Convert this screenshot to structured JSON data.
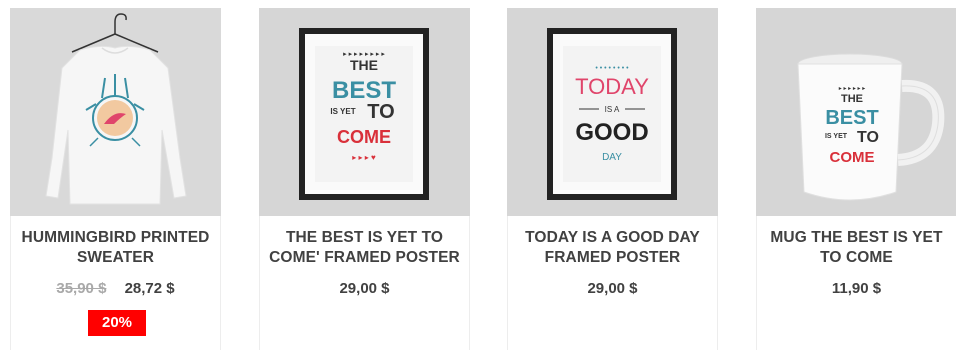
{
  "products": [
    {
      "title": "HUMMINGBIRD PRINTED SWEATER",
      "old_price": "35,90 $",
      "price": "28,72 $",
      "discount": "20%"
    },
    {
      "title": "THE BEST IS YET TO COME' FRAMED POSTER",
      "price": "29,00 $",
      "poster_text": {
        "the": "THE",
        "best": "BEST",
        "is_yet": "IS YET",
        "to": "TO",
        "come": "COME"
      }
    },
    {
      "title": "TODAY IS A GOOD DAY FRAMED POSTER",
      "price": "29,00 $",
      "poster_text": {
        "today": "TODAY",
        "is_a": "IS A",
        "good": "GOOD",
        "day": "DAY"
      }
    },
    {
      "title": "MUG THE BEST IS YET TO COME",
      "price": "11,90 $",
      "mug_text": {
        "the": "THE",
        "best": "BEST",
        "is_yet": "IS YET",
        "to": "TO",
        "come": "COME"
      }
    }
  ],
  "colors": {
    "discount_bg": "#ff0000",
    "teal": "#3a8fa3",
    "red": "#d9303a",
    "pink": "#e0456b",
    "frame": "#222222"
  }
}
